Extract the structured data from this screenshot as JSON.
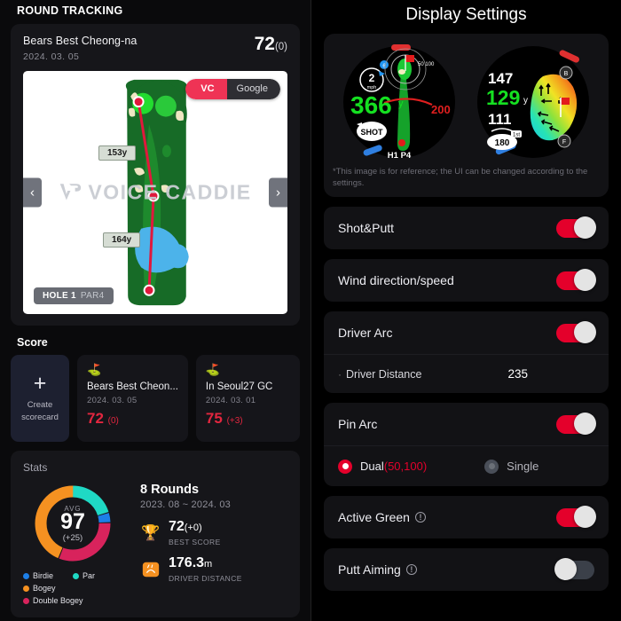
{
  "left": {
    "section_title": "ROUND TRACKING",
    "round": {
      "course": "Bears Best Cheong-na",
      "date": "2024. 03. 05",
      "score": "72",
      "score_delta": "(0)",
      "map": {
        "toggle_vc": "VC",
        "toggle_google": "Google",
        "watermark": "VOICE CADDIE",
        "distance_top": "153y",
        "distance_bottom": "164y",
        "hole": "HOLE 1",
        "par": "PAR4",
        "prev_icon": "chevron-left-icon",
        "next_icon": "chevron-right-icon"
      }
    },
    "score_section": {
      "title": "Score",
      "create": {
        "line1": "Create",
        "line2": "scorecard",
        "icon": "plus-icon"
      },
      "cards": [
        {
          "name": "Bears Best Cheon...",
          "date": "2024. 03. 05",
          "score": "72",
          "delta": "(0)"
        },
        {
          "name": "In Seoul27 GC",
          "date": "2024. 03. 01",
          "score": "75",
          "delta": "(+3)"
        }
      ]
    },
    "stats": {
      "title": "Stats",
      "avg_label": "AVG",
      "avg_value": "97",
      "avg_delta": "(+25)",
      "rounds": "8 Rounds",
      "range": "2023. 08 ~ 2024. 03",
      "best_score": "72",
      "best_score_delta": "(+0)",
      "best_score_caption": "BEST SCORE",
      "driver_distance": "176.3",
      "driver_unit": "m",
      "driver_caption": "DRIVER DISTANCE",
      "legend": [
        {
          "label": "Birdie",
          "color": "#1d7fe8"
        },
        {
          "label": "Par",
          "color": "#1fd9c4"
        },
        {
          "label": "Bogey",
          "color": "#f59121"
        },
        {
          "label": "Double Bogey",
          "color": "#d8235c"
        }
      ]
    }
  },
  "chart_data": {
    "type": "pie",
    "title": "Stats",
    "categories": [
      "Par",
      "Birdie",
      "Double Bogey",
      "Bogey"
    ],
    "values": [
      20,
      4,
      31,
      45
    ],
    "colors": [
      "#1fd9c4",
      "#1d7fe8",
      "#d8235c",
      "#f59121"
    ],
    "center_label": "AVG",
    "center_value": 97,
    "center_delta": "+25",
    "legend_position": "bottom",
    "donut": true
  },
  "right": {
    "title": "Display Settings",
    "preview": {
      "note": "*This image is for reference; the UI can be changed according to the settings.",
      "watch1": {
        "wind_speed": "2",
        "wind_unit": "mph",
        "main_distance": "366",
        "main_unit": "y",
        "back_distance": "200",
        "shot_label": "SHOT",
        "hole_label": "H1 P4",
        "arc_labels": "50 100"
      },
      "watch2": {
        "back": "147",
        "center": "129",
        "center_unit": "y",
        "front": "111",
        "putt_distance": "180",
        "putt_unit": "1st",
        "marker_back": "B",
        "marker_front": "F"
      }
    },
    "settings": [
      {
        "label": "Shot&Putt",
        "toggle": "on"
      },
      {
        "label": "Wind direction/speed",
        "toggle": "on"
      },
      {
        "label": "Driver Arc",
        "toggle": "on"
      },
      {
        "label": "Pin Arc",
        "toggle": "on"
      },
      {
        "label": "Active Green",
        "toggle": "on",
        "info": true
      },
      {
        "label": "Putt Aiming",
        "toggle": "off",
        "info": true
      }
    ],
    "driver_distance": {
      "label": "Driver Distance",
      "value": "235"
    },
    "pin_arc_options": {
      "dual_label": "Dual",
      "dual_value": "(50,100)",
      "single_label": "Single",
      "selected": "dual"
    }
  }
}
